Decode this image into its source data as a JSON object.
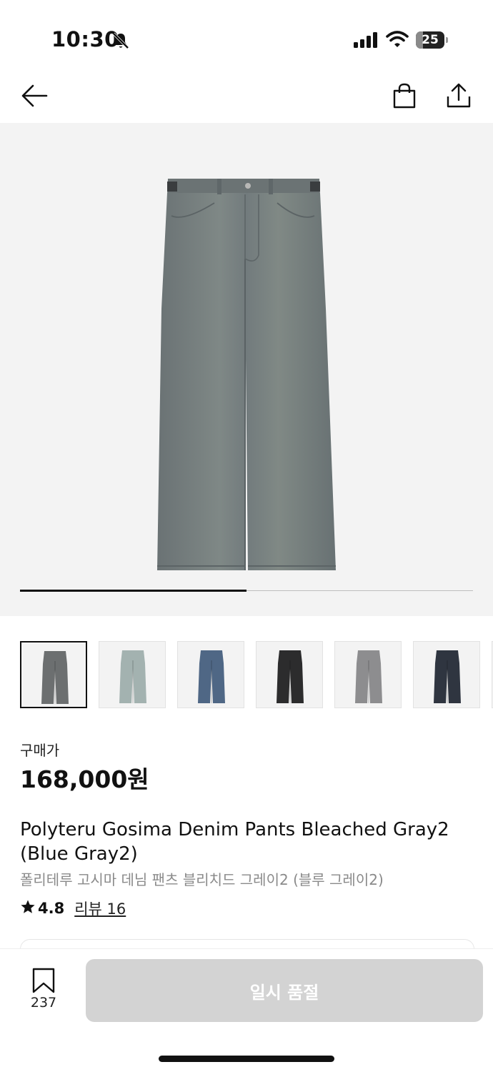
{
  "status_bar": {
    "time": "10:30",
    "battery_level": "25",
    "battery_fraction": 0.25
  },
  "nav": {
    "back_icon": "arrow-left-icon",
    "cart_icon": "shopping-bag-icon",
    "share_icon": "share-icon"
  },
  "gallery": {
    "progress_fraction": 0.5,
    "main_color": "#707a7c"
  },
  "thumbnails": [
    {
      "color": "#6c6f70",
      "selected": true
    },
    {
      "color": "#a3b2b0",
      "selected": false
    },
    {
      "color": "#4f6785",
      "selected": false
    },
    {
      "color": "#2c2c2d",
      "selected": false
    },
    {
      "color": "#8d8d8f",
      "selected": false
    },
    {
      "color": "#2f3540",
      "selected": false
    }
  ],
  "price": {
    "label": "구매가",
    "value": "168,000원"
  },
  "product": {
    "name_en": "Polyteru Gosima Denim Pants Bleached Gray2 (Blue Gray2)",
    "name_ko": "폴리테루 고시마 데님 팬츠 블리치드 그레이2 (블루 그레이2)",
    "rating": "4.8",
    "reviews": "리뷰 16"
  },
  "footer": {
    "bookmark_count": "237",
    "cta_label": "일시 품절"
  },
  "colors": {
    "accent": "#111111",
    "disabled": "#d3d3d3",
    "muted_text": "#8a8a8a"
  }
}
